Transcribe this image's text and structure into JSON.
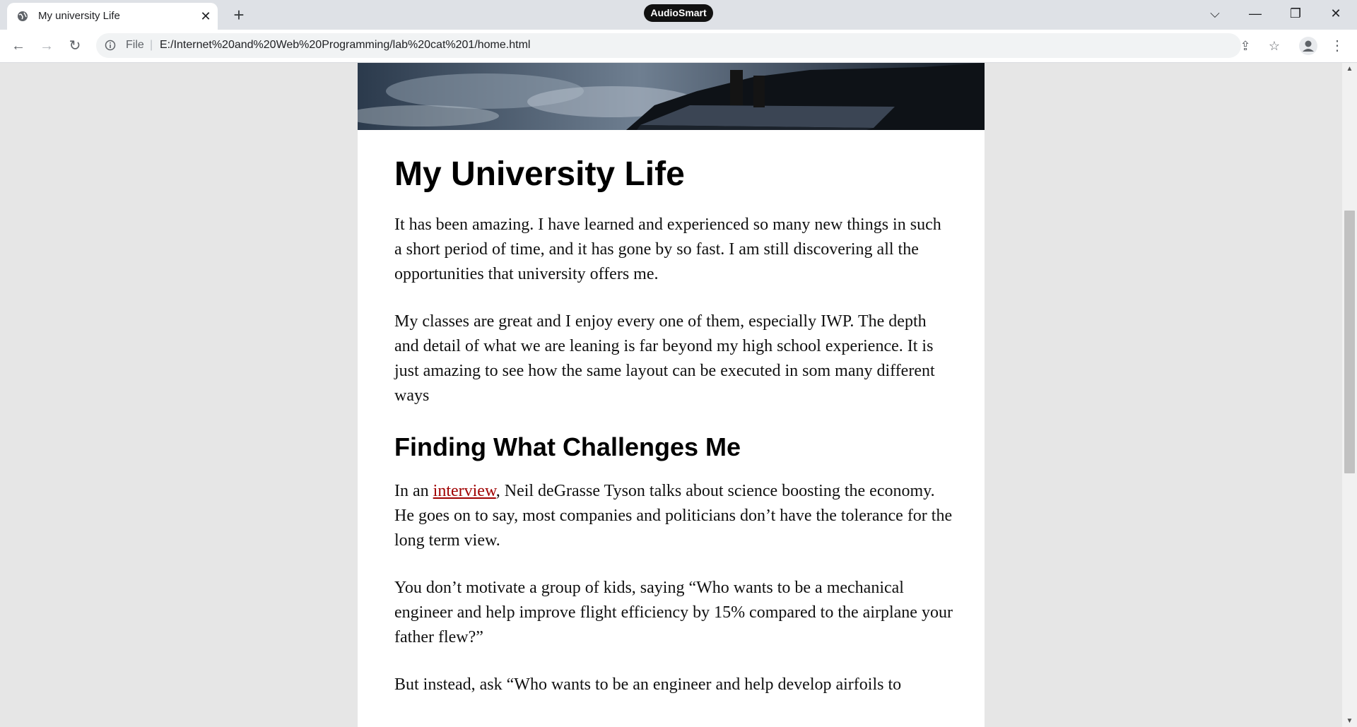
{
  "browser": {
    "tab_title": "My university Life",
    "new_tab_symbol": "+",
    "extension_label": "AudioSmart",
    "scheme_label": "File",
    "url": "E:/Internet%20and%20Web%20Programming/lab%20cat%201/home.html"
  },
  "icons": {
    "favicon": "globe-icon",
    "back": "back-arrow-icon",
    "forward": "forward-arrow-icon",
    "reload": "reload-icon",
    "info": "info-icon",
    "share": "share-icon",
    "bookmark": "star-icon",
    "profile": "profile-icon",
    "menu": "kebab-menu-icon"
  },
  "page": {
    "title": "My University Life",
    "para1": "It has been amazing. I have learned and experienced so many new things in such a short period of time, and it has gone by so fast. I am still discovering all the opportunities that university offers me.",
    "para2": "My classes are great and I enjoy every one of them, especially IWP. The depth and detail of what we are leaning is far beyond my high school experience. It is just amazing to see how the same layout can be executed in som many different ways",
    "section_title": "Finding What Challenges Me",
    "para3_before": "In an ",
    "para3_link": "interview",
    "para3_after": ", Neil deGrasse Tyson talks about science boosting the economy. He goes on to say, most companies and politicians don’t have the tolerance for the long term view.",
    "para4": "You don’t motivate a group of kids, saying “Who wants to be a mechanical engineer and help improve flight efficiency by 15% compared to the airplane your father flew?”",
    "para5": "But instead, ask “Who wants to be an engineer and help develop airfoils to"
  },
  "colors": {
    "link": "#a00000",
    "page_background": "#e6e6e6",
    "card_background": "#ffffff"
  }
}
